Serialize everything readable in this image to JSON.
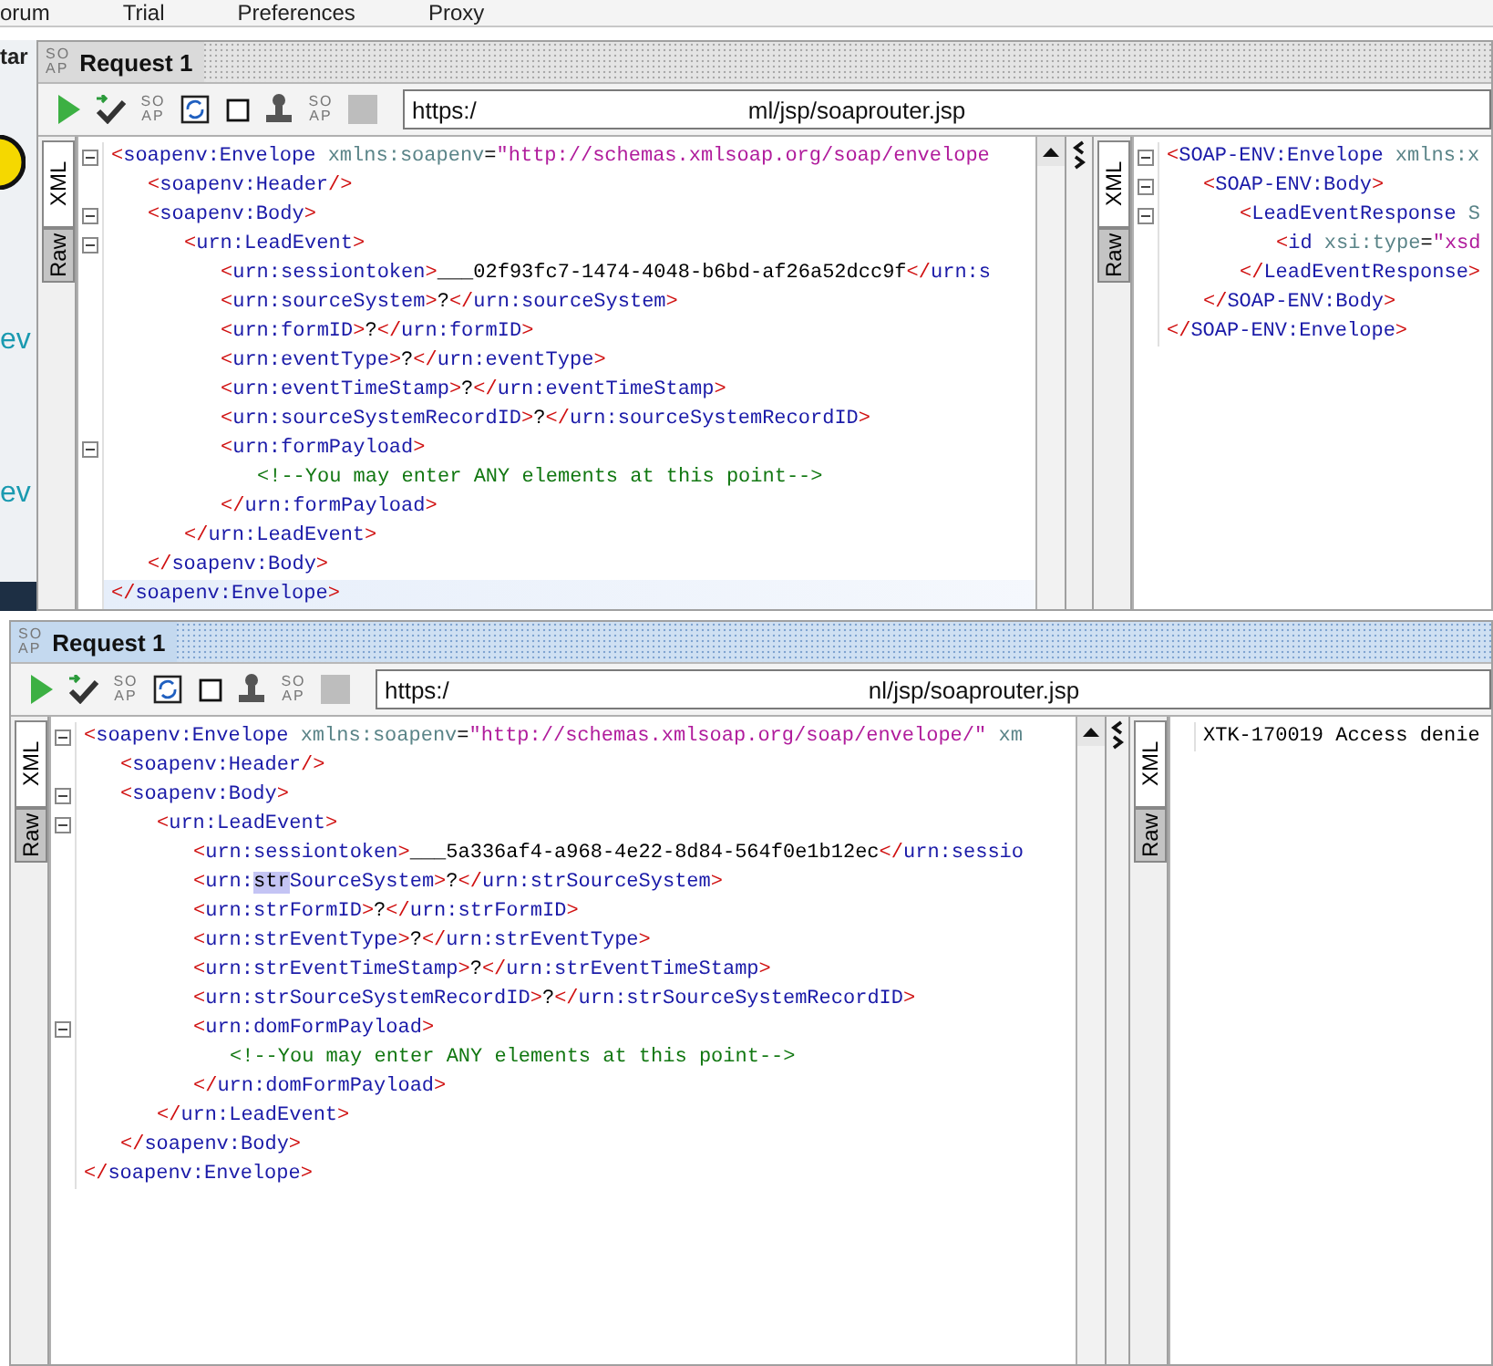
{
  "menu": [
    {
      "label": "orum"
    },
    {
      "label": "Trial"
    },
    {
      "label": "Preferences"
    },
    {
      "label": "Proxy"
    }
  ],
  "side_strip": {
    "tab": "tar",
    "links": [
      "ev",
      "ev"
    ]
  },
  "panels": [
    {
      "title": "Request 1",
      "active": false,
      "icon": [
        "SO",
        "AP"
      ],
      "toolbar": [
        {
          "kind": "run"
        },
        {
          "kind": "submit"
        },
        {
          "kind": "soap",
          "lines": [
            "SO",
            "AP"
          ]
        },
        {
          "kind": "refresh"
        },
        {
          "kind": "box"
        },
        {
          "kind": "stamp"
        },
        {
          "kind": "soap",
          "lines": [
            "SO",
            "AP"
          ]
        },
        {
          "kind": "stop"
        }
      ],
      "url": {
        "start": "https:/",
        "end": "ml/jsp/soaprouter.jsp"
      },
      "request": {
        "tabs": [
          {
            "label": "XML",
            "selected": true
          },
          {
            "label": "Raw",
            "selected": false
          }
        ],
        "lines": [
          {
            "current": false,
            "parts": [
              {
                "kind": "punct",
                "text": "<"
              },
              {
                "kind": "tag",
                "text": "soapenv:Envelope"
              },
              {
                "kind": "attr",
                "text": " xmlns:soapenv"
              },
              {
                "kind": "text",
                "text": "="
              },
              {
                "kind": "value",
                "text": "\"http://schemas.xmlsoap.org/soap/envelope"
              }
            ],
            "children": [
              {
                "current": false,
                "parts": [
                  {
                    "kind": "punct",
                    "text": "<"
                  },
                  {
                    "kind": "tag",
                    "text": "soapenv:Header"
                  },
                  {
                    "kind": "punct",
                    "text": "/>"
                  }
                ]
              },
              {
                "current": false,
                "parts": [
                  {
                    "kind": "punct",
                    "text": "<"
                  },
                  {
                    "kind": "tag",
                    "text": "soapenv:Body"
                  },
                  {
                    "kind": "punct",
                    "text": ">"
                  }
                ],
                "children": [
                  {
                    "current": false,
                    "parts": [
                      {
                        "kind": "punct",
                        "text": "<"
                      },
                      {
                        "kind": "tag",
                        "text": "urn:LeadEvent"
                      },
                      {
                        "kind": "punct",
                        "text": ">"
                      }
                    ],
                    "children": [
                      {
                        "current": false,
                        "parts": [
                          {
                            "kind": "punct",
                            "text": "<"
                          },
                          {
                            "kind": "tag",
                            "text": "urn:sessiontoken"
                          },
                          {
                            "kind": "punct",
                            "text": ">"
                          },
                          {
                            "kind": "text",
                            "text": "___02f93fc7-1474-4048-b6bd-af26a52dcc9f"
                          },
                          {
                            "kind": "punct",
                            "text": "</"
                          },
                          {
                            "kind": "tag",
                            "text": "urn:s"
                          }
                        ]
                      },
                      {
                        "current": false,
                        "parts": [
                          {
                            "kind": "punct",
                            "text": "<"
                          },
                          {
                            "kind": "tag",
                            "text": "urn:sourceSystem"
                          },
                          {
                            "kind": "punct",
                            "text": ">"
                          },
                          {
                            "kind": "text",
                            "text": "?"
                          },
                          {
                            "kind": "punct",
                            "text": "</"
                          },
                          {
                            "kind": "tag",
                            "text": "urn:sourceSystem"
                          },
                          {
                            "kind": "punct",
                            "text": ">"
                          }
                        ]
                      },
                      {
                        "current": false,
                        "parts": [
                          {
                            "kind": "punct",
                            "text": "<"
                          },
                          {
                            "kind": "tag",
                            "text": "urn:formID"
                          },
                          {
                            "kind": "punct",
                            "text": ">"
                          },
                          {
                            "kind": "text",
                            "text": "?"
                          },
                          {
                            "kind": "punct",
                            "text": "</"
                          },
                          {
                            "kind": "tag",
                            "text": "urn:formID"
                          },
                          {
                            "kind": "punct",
                            "text": ">"
                          }
                        ]
                      },
                      {
                        "current": false,
                        "parts": [
                          {
                            "kind": "punct",
                            "text": "<"
                          },
                          {
                            "kind": "tag",
                            "text": "urn:eventType"
                          },
                          {
                            "kind": "punct",
                            "text": ">"
                          },
                          {
                            "kind": "text",
                            "text": "?"
                          },
                          {
                            "kind": "punct",
                            "text": "</"
                          },
                          {
                            "kind": "tag",
                            "text": "urn:eventType"
                          },
                          {
                            "kind": "punct",
                            "text": ">"
                          }
                        ]
                      },
                      {
                        "current": false,
                        "parts": [
                          {
                            "kind": "punct",
                            "text": "<"
                          },
                          {
                            "kind": "tag",
                            "text": "urn:eventTimeStamp"
                          },
                          {
                            "kind": "punct",
                            "text": ">"
                          },
                          {
                            "kind": "text",
                            "text": "?"
                          },
                          {
                            "kind": "punct",
                            "text": "</"
                          },
                          {
                            "kind": "tag",
                            "text": "urn:eventTimeStamp"
                          },
                          {
                            "kind": "punct",
                            "text": ">"
                          }
                        ]
                      },
                      {
                        "current": false,
                        "parts": [
                          {
                            "kind": "punct",
                            "text": "<"
                          },
                          {
                            "kind": "tag",
                            "text": "urn:sourceSystemRecordID"
                          },
                          {
                            "kind": "punct",
                            "text": ">"
                          },
                          {
                            "kind": "text",
                            "text": "?"
                          },
                          {
                            "kind": "punct",
                            "text": "</"
                          },
                          {
                            "kind": "tag",
                            "text": "urn:sourceSystemRecordID"
                          },
                          {
                            "kind": "punct",
                            "text": ">"
                          }
                        ]
                      },
                      {
                        "current": false,
                        "parts": [
                          {
                            "kind": "punct",
                            "text": "<"
                          },
                          {
                            "kind": "tag",
                            "text": "urn:formPayload"
                          },
                          {
                            "kind": "punct",
                            "text": ">"
                          }
                        ],
                        "children": [
                          {
                            "current": false,
                            "parts": [
                              {
                                "kind": "comment",
                                "text": "<!--You may enter ANY elements at this point-->"
                              }
                            ]
                          }
                        ]
                      },
                      {
                        "current": false,
                        "parts": [
                          {
                            "kind": "punct",
                            "text": "</"
                          },
                          {
                            "kind": "tag",
                            "text": "urn:formPayload"
                          },
                          {
                            "kind": "punct",
                            "text": ">"
                          }
                        ]
                      }
                    ]
                  },
                  {
                    "current": false,
                    "parts": [
                      {
                        "kind": "punct",
                        "text": "</"
                      },
                      {
                        "kind": "tag",
                        "text": "urn:LeadEvent"
                      },
                      {
                        "kind": "punct",
                        "text": ">"
                      }
                    ]
                  }
                ]
              },
              {
                "current": false,
                "parts": [
                  {
                    "kind": "punct",
                    "text": "</"
                  },
                  {
                    "kind": "tag",
                    "text": "soapenv:Body"
                  },
                  {
                    "kind": "punct",
                    "text": ">"
                  }
                ]
              }
            ]
          },
          {
            "current": true,
            "parts": [
              {
                "kind": "punct",
                "text": "</"
              },
              {
                "kind": "tag",
                "text": "soapenv:Envelope"
              },
              {
                "kind": "punct",
                "text": ">"
              }
            ]
          }
        ]
      },
      "response": {
        "tabs": [
          {
            "label": "XML",
            "selected": true
          },
          {
            "label": "Raw",
            "selected": false
          }
        ],
        "lines": [
          {
            "current": false,
            "parts": [
              {
                "kind": "punct",
                "text": "<"
              },
              {
                "kind": "tag",
                "text": "SOAP-ENV:Envelope"
              },
              {
                "kind": "attr",
                "text": " xmlns:x"
              }
            ],
            "children": [
              {
                "current": false,
                "parts": [
                  {
                    "kind": "punct",
                    "text": "<"
                  },
                  {
                    "kind": "tag",
                    "text": "SOAP-ENV:Body"
                  },
                  {
                    "kind": "punct",
                    "text": ">"
                  }
                ],
                "children": [
                  {
                    "current": false,
                    "parts": [
                      {
                        "kind": "punct",
                        "text": "<"
                      },
                      {
                        "kind": "tag",
                        "text": "LeadEventResponse"
                      },
                      {
                        "kind": "attr",
                        "text": " S"
                      }
                    ],
                    "children": [
                      {
                        "current": false,
                        "parts": [
                          {
                            "kind": "punct",
                            "text": "<"
                          },
                          {
                            "kind": "tag",
                            "text": "id"
                          },
                          {
                            "kind": "attr",
                            "text": " xsi:type"
                          },
                          {
                            "kind": "text",
                            "text": "="
                          },
                          {
                            "kind": "value",
                            "text": "\"xsd"
                          }
                        ]
                      }
                    ]
                  },
                  {
                    "current": false,
                    "parts": [
                      {
                        "kind": "punct",
                        "text": "</"
                      },
                      {
                        "kind": "tag",
                        "text": "LeadEventResponse"
                      },
                      {
                        "kind": "punct",
                        "text": ">"
                      }
                    ]
                  }
                ]
              },
              {
                "current": false,
                "parts": [
                  {
                    "kind": "punct",
                    "text": "</"
                  },
                  {
                    "kind": "tag",
                    "text": "SOAP-ENV:Body"
                  },
                  {
                    "kind": "punct",
                    "text": ">"
                  }
                ]
              }
            ]
          },
          {
            "current": false,
            "parts": [
              {
                "kind": "punct",
                "text": "</"
              },
              {
                "kind": "tag",
                "text": "SOAP-ENV:Envelope"
              },
              {
                "kind": "punct",
                "text": ">"
              }
            ]
          }
        ]
      }
    },
    {
      "title": "Request 1",
      "active": true,
      "icon": [
        "SO",
        "AP"
      ],
      "toolbar": [
        {
          "kind": "run"
        },
        {
          "kind": "submit"
        },
        {
          "kind": "soap",
          "lines": [
            "SO",
            "AP"
          ]
        },
        {
          "kind": "refresh"
        },
        {
          "kind": "box"
        },
        {
          "kind": "stamp"
        },
        {
          "kind": "soap",
          "lines": [
            "SO",
            "AP"
          ]
        },
        {
          "kind": "stop"
        }
      ],
      "url": {
        "start": "https:/",
        "end": "nl/jsp/soaprouter.jsp"
      },
      "request": {
        "tabs": [
          {
            "label": "XML",
            "selected": true
          },
          {
            "label": "Raw",
            "selected": false
          }
        ],
        "lines": [
          {
            "current": false,
            "parts": [
              {
                "kind": "punct",
                "text": "<"
              },
              {
                "kind": "tag",
                "text": "soapenv:Envelope"
              },
              {
                "kind": "attr",
                "text": " xmlns:soapenv"
              },
              {
                "kind": "text",
                "text": "="
              },
              {
                "kind": "value",
                "text": "\"http://schemas.xmlsoap.org/soap/envelope/\""
              },
              {
                "kind": "attr",
                "text": " xm"
              }
            ],
            "children": [
              {
                "current": false,
                "parts": [
                  {
                    "kind": "punct",
                    "text": "<"
                  },
                  {
                    "kind": "tag",
                    "text": "soapenv:Header"
                  },
                  {
                    "kind": "punct",
                    "text": "/>"
                  }
                ]
              },
              {
                "current": false,
                "parts": [
                  {
                    "kind": "punct",
                    "text": "<"
                  },
                  {
                    "kind": "tag",
                    "text": "soapenv:Body"
                  },
                  {
                    "kind": "punct",
                    "text": ">"
                  }
                ],
                "children": [
                  {
                    "current": false,
                    "parts": [
                      {
                        "kind": "punct",
                        "text": "<"
                      },
                      {
                        "kind": "tag",
                        "text": "urn:LeadEvent"
                      },
                      {
                        "kind": "punct",
                        "text": ">"
                      }
                    ],
                    "children": [
                      {
                        "current": false,
                        "parts": [
                          {
                            "kind": "punct",
                            "text": "<"
                          },
                          {
                            "kind": "tag",
                            "text": "urn:sessiontoken"
                          },
                          {
                            "kind": "punct",
                            "text": ">"
                          },
                          {
                            "kind": "text",
                            "text": "___5a336af4-a968-4e22-8d84-564f0e1b12ec"
                          },
                          {
                            "kind": "punct",
                            "text": "</"
                          },
                          {
                            "kind": "tag",
                            "text": "urn:sessio"
                          }
                        ]
                      },
                      {
                        "current": false,
                        "parts": [
                          {
                            "kind": "punct",
                            "text": "<"
                          },
                          {
                            "kind": "tag",
                            "text": "urn:"
                          },
                          {
                            "kind": "selected",
                            "text": "str"
                          },
                          {
                            "kind": "tag",
                            "text": "SourceSystem"
                          },
                          {
                            "kind": "punct",
                            "text": ">"
                          },
                          {
                            "kind": "text",
                            "text": "?"
                          },
                          {
                            "kind": "punct",
                            "text": "</"
                          },
                          {
                            "kind": "tag",
                            "text": "urn:strSourceSystem"
                          },
                          {
                            "kind": "punct",
                            "text": ">"
                          }
                        ]
                      },
                      {
                        "current": false,
                        "parts": [
                          {
                            "kind": "punct",
                            "text": "<"
                          },
                          {
                            "kind": "tag",
                            "text": "urn:strFormID"
                          },
                          {
                            "kind": "punct",
                            "text": ">"
                          },
                          {
                            "kind": "text",
                            "text": "?"
                          },
                          {
                            "kind": "punct",
                            "text": "</"
                          },
                          {
                            "kind": "tag",
                            "text": "urn:strFormID"
                          },
                          {
                            "kind": "punct",
                            "text": ">"
                          }
                        ]
                      },
                      {
                        "current": false,
                        "parts": [
                          {
                            "kind": "punct",
                            "text": "<"
                          },
                          {
                            "kind": "tag",
                            "text": "urn:strEventType"
                          },
                          {
                            "kind": "punct",
                            "text": ">"
                          },
                          {
                            "kind": "text",
                            "text": "?"
                          },
                          {
                            "kind": "punct",
                            "text": "</"
                          },
                          {
                            "kind": "tag",
                            "text": "urn:strEventType"
                          },
                          {
                            "kind": "punct",
                            "text": ">"
                          }
                        ]
                      },
                      {
                        "current": false,
                        "parts": [
                          {
                            "kind": "punct",
                            "text": "<"
                          },
                          {
                            "kind": "tag",
                            "text": "urn:strEventTimeStamp"
                          },
                          {
                            "kind": "punct",
                            "text": ">"
                          },
                          {
                            "kind": "text",
                            "text": "?"
                          },
                          {
                            "kind": "punct",
                            "text": "</"
                          },
                          {
                            "kind": "tag",
                            "text": "urn:strEventTimeStamp"
                          },
                          {
                            "kind": "punct",
                            "text": ">"
                          }
                        ]
                      },
                      {
                        "current": false,
                        "parts": [
                          {
                            "kind": "punct",
                            "text": "<"
                          },
                          {
                            "kind": "tag",
                            "text": "urn:strSourceSystemRecordID"
                          },
                          {
                            "kind": "punct",
                            "text": ">"
                          },
                          {
                            "kind": "text",
                            "text": "?"
                          },
                          {
                            "kind": "punct",
                            "text": "</"
                          },
                          {
                            "kind": "tag",
                            "text": "urn:strSourceSystemRecordID"
                          },
                          {
                            "kind": "punct",
                            "text": ">"
                          }
                        ]
                      },
                      {
                        "current": false,
                        "parts": [
                          {
                            "kind": "punct",
                            "text": "<"
                          },
                          {
                            "kind": "tag",
                            "text": "urn:domFormPayload"
                          },
                          {
                            "kind": "punct",
                            "text": ">"
                          }
                        ],
                        "children": [
                          {
                            "current": false,
                            "parts": [
                              {
                                "kind": "comment",
                                "text": "<!--You may enter ANY elements at this point-->"
                              }
                            ]
                          }
                        ]
                      },
                      {
                        "current": false,
                        "parts": [
                          {
                            "kind": "punct",
                            "text": "</"
                          },
                          {
                            "kind": "tag",
                            "text": "urn:domFormPayload"
                          },
                          {
                            "kind": "punct",
                            "text": ">"
                          }
                        ]
                      }
                    ]
                  },
                  {
                    "current": false,
                    "parts": [
                      {
                        "kind": "punct",
                        "text": "</"
                      },
                      {
                        "kind": "tag",
                        "text": "urn:LeadEvent"
                      },
                      {
                        "kind": "punct",
                        "text": ">"
                      }
                    ]
                  }
                ]
              },
              {
                "current": false,
                "parts": [
                  {
                    "kind": "punct",
                    "text": "</"
                  },
                  {
                    "kind": "tag",
                    "text": "soapenv:Body"
                  },
                  {
                    "kind": "punct",
                    "text": ">"
                  }
                ]
              }
            ]
          },
          {
            "current": false,
            "parts": [
              {
                "kind": "punct",
                "text": "</"
              },
              {
                "kind": "tag",
                "text": "soapenv:Envelope"
              },
              {
                "kind": "punct",
                "text": ">"
              }
            ]
          }
        ]
      },
      "response": {
        "tabs": [
          {
            "label": "XML",
            "selected": true
          },
          {
            "label": "Raw",
            "selected": false
          }
        ],
        "lines": [
          {
            "current": false,
            "parts": [
              {
                "kind": "text",
                "text": "XTK-170019 Access denie"
              }
            ]
          }
        ]
      }
    }
  ]
}
